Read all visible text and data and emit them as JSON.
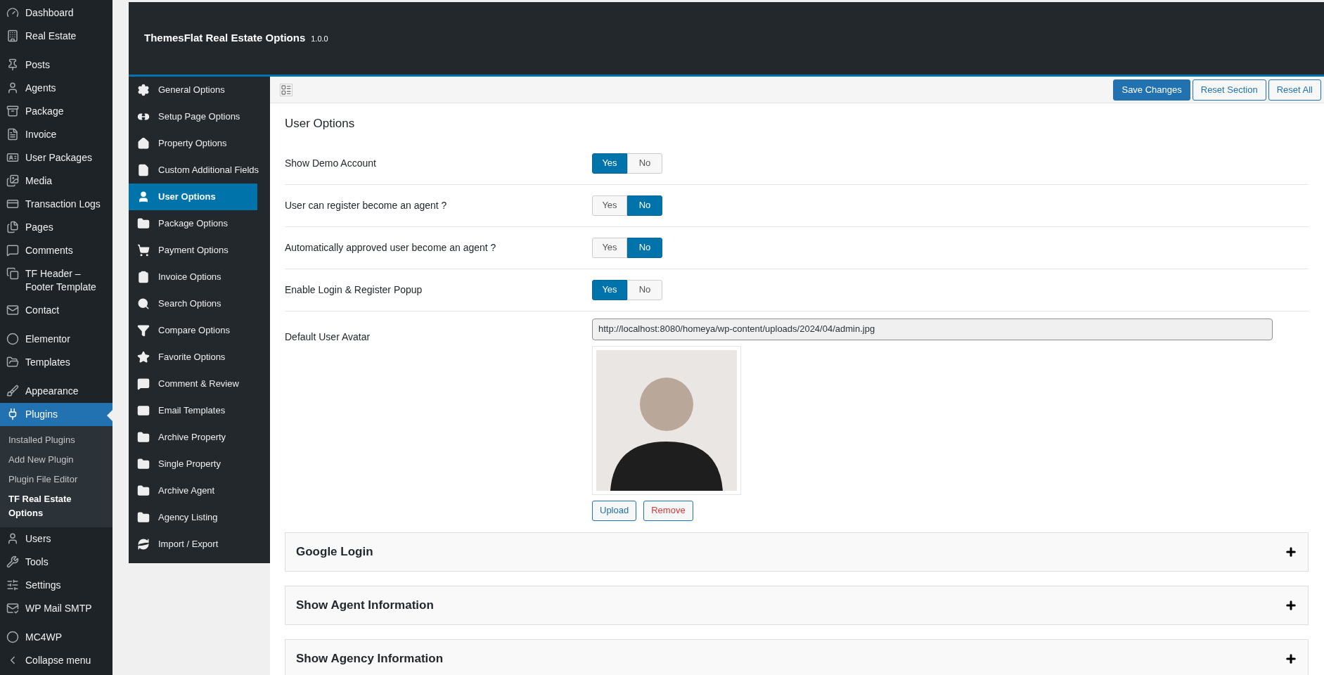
{
  "admin_menu": {
    "groups": [
      [
        {
          "label": "Dashboard",
          "selected": false
        },
        {
          "label": "Real Estate",
          "selected": false
        }
      ],
      [
        {
          "label": "Posts",
          "selected": false
        },
        {
          "label": "Agents",
          "selected": false
        },
        {
          "label": "Package",
          "selected": false
        },
        {
          "label": "Invoice",
          "selected": false
        },
        {
          "label": "User Packages",
          "selected": false
        },
        {
          "label": "Media",
          "selected": false
        },
        {
          "label": "Transaction Logs",
          "selected": false
        },
        {
          "label": "Pages",
          "selected": false
        },
        {
          "label": "Comments",
          "selected": false
        },
        {
          "label": "TF Header – Footer Template",
          "selected": false
        },
        {
          "label": "Contact",
          "selected": false
        }
      ],
      [
        {
          "label": "Elementor",
          "selected": false
        },
        {
          "label": "Templates",
          "selected": false
        }
      ],
      [
        {
          "label": "Appearance",
          "selected": false
        },
        {
          "label": "Plugins",
          "selected": true,
          "children": [
            {
              "label": "Installed Plugins",
              "selected": false
            },
            {
              "label": "Add New Plugin",
              "selected": false
            },
            {
              "label": "Plugin File Editor",
              "selected": false
            },
            {
              "label": "TF Real Estate Options",
              "selected": true
            }
          ]
        },
        {
          "label": "Users",
          "selected": false
        },
        {
          "label": "Tools",
          "selected": false
        },
        {
          "label": "Settings",
          "selected": false
        },
        {
          "label": "WP Mail SMTP",
          "selected": false
        }
      ],
      [
        {
          "label": "MC4WP",
          "selected": false
        },
        {
          "label": "Collapse menu",
          "selected": false
        }
      ]
    ]
  },
  "header": {
    "title": "ThemesFlat Real Estate Options",
    "version": "1.0.0"
  },
  "options_nav": [
    {
      "label": "General Options",
      "selected": false
    },
    {
      "label": "Setup Page Options",
      "selected": false
    },
    {
      "label": "Property Options",
      "selected": false
    },
    {
      "label": "Custom Additional Fields",
      "selected": false
    },
    {
      "label": "User Options",
      "selected": true
    },
    {
      "label": "Package Options",
      "selected": false
    },
    {
      "label": "Payment Options",
      "selected": false
    },
    {
      "label": "Invoice Options",
      "selected": false
    },
    {
      "label": "Search Options",
      "selected": false
    },
    {
      "label": "Compare Options",
      "selected": false
    },
    {
      "label": "Favorite Options",
      "selected": false
    },
    {
      "label": "Comment & Review",
      "selected": false
    },
    {
      "label": "Email Templates",
      "selected": false
    },
    {
      "label": "Archive Property",
      "selected": false
    },
    {
      "label": "Single Property",
      "selected": false
    },
    {
      "label": "Archive Agent",
      "selected": false
    },
    {
      "label": "Agency Listing",
      "selected": false
    },
    {
      "label": "Import / Export",
      "selected": false
    }
  ],
  "toolbar": {
    "buttons": [
      {
        "label": "Save Changes",
        "kind": "primary"
      },
      {
        "label": "Reset Section",
        "kind": "secondary"
      },
      {
        "label": "Reset All",
        "kind": "secondary"
      }
    ]
  },
  "section": {
    "title": "User Options",
    "fields": [
      {
        "kind": "switch",
        "label": "Show Demo Account",
        "options": [
          {
            "label": "Yes",
            "selected": true
          },
          {
            "label": "No",
            "selected": false
          }
        ]
      },
      {
        "kind": "switch",
        "label": "User can register become an agent ?",
        "options": [
          {
            "label": "Yes",
            "selected": false
          },
          {
            "label": "No",
            "selected": true
          }
        ]
      },
      {
        "kind": "switch",
        "label": "Automatically approved user become an agent ?",
        "options": [
          {
            "label": "Yes",
            "selected": false
          },
          {
            "label": "No",
            "selected": true
          }
        ]
      },
      {
        "kind": "switch",
        "label": "Enable Login & Register Popup",
        "options": [
          {
            "label": "Yes",
            "selected": true
          },
          {
            "label": "No",
            "selected": false
          }
        ]
      },
      {
        "kind": "media",
        "label": "Default User Avatar",
        "value": "http://localhost:8080/homeya/wp-content/uploads/2024/04/admin.jpg",
        "upload": "Upload",
        "remove": "Remove"
      }
    ],
    "accordions": [
      {
        "title": "Google Login",
        "expanded": false
      },
      {
        "title": "Show Agent Information",
        "expanded": false
      },
      {
        "title": "Show Agency Information",
        "expanded": false
      }
    ]
  }
}
